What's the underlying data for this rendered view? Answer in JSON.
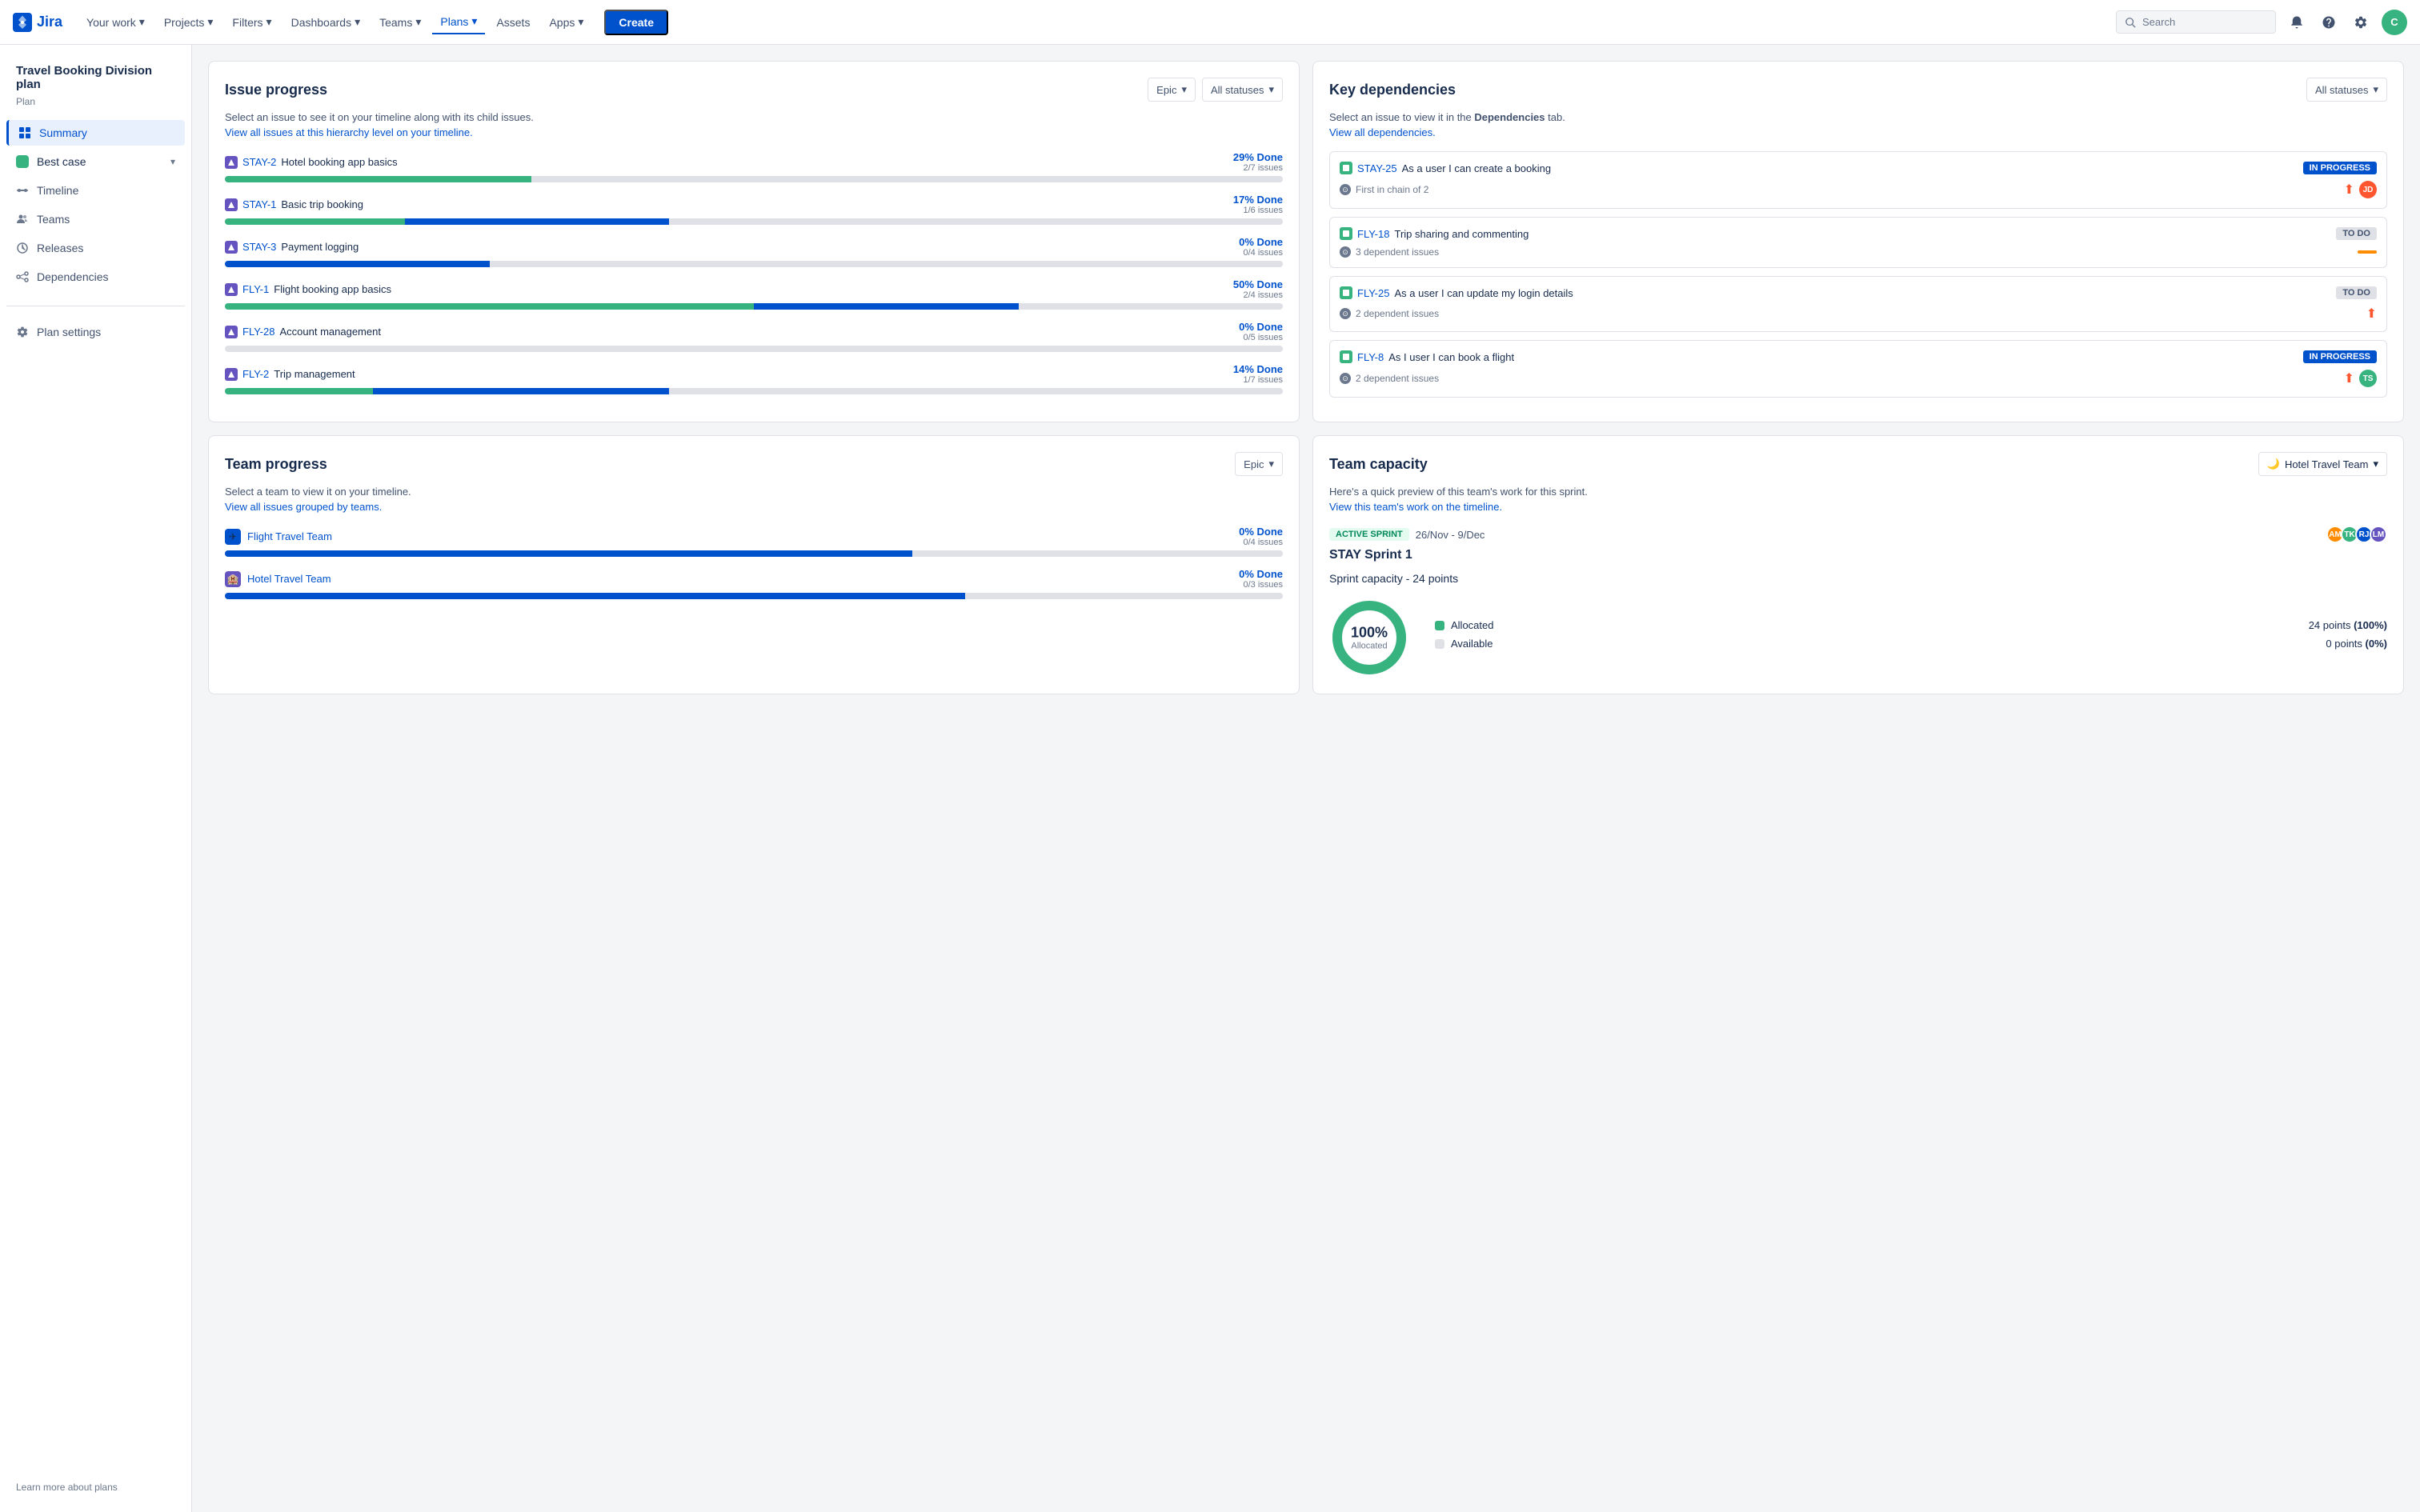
{
  "topnav": {
    "logo_text": "Jira",
    "items": [
      {
        "label": "Your work",
        "has_arrow": true
      },
      {
        "label": "Projects",
        "has_arrow": true
      },
      {
        "label": "Filters",
        "has_arrow": true
      },
      {
        "label": "Dashboards",
        "has_arrow": true
      },
      {
        "label": "Teams",
        "has_arrow": true
      },
      {
        "label": "Plans",
        "has_arrow": true,
        "active": true
      },
      {
        "label": "Assets"
      },
      {
        "label": "Apps",
        "has_arrow": true
      }
    ],
    "create_label": "Create",
    "search_placeholder": "Search",
    "avatar_initials": "C"
  },
  "sidebar": {
    "plan_title": "Travel Booking Division plan",
    "plan_subtitle": "Plan",
    "items": [
      {
        "label": "Summary",
        "active": true,
        "icon": "grid"
      },
      {
        "label": "Best case",
        "is_scenario": true
      },
      {
        "label": "Timeline",
        "icon": "timeline"
      },
      {
        "label": "Teams",
        "icon": "teams"
      },
      {
        "label": "Releases",
        "icon": "releases"
      },
      {
        "label": "Dependencies",
        "icon": "dependencies"
      }
    ],
    "settings_label": "Plan settings",
    "footer_link": "Learn more about plans"
  },
  "issue_progress": {
    "title": "Issue progress",
    "filter1": "Epic",
    "filter2": "All statuses",
    "subtitle": "Select an issue to see it on your timeline along with its child issues.",
    "link": "View all issues at this hierarchy level on your timeline.",
    "issues": [
      {
        "id": "STAY-2",
        "name": "Hotel booking app basics",
        "pct": "29% Done",
        "count": "2/7 issues",
        "green": 29,
        "blue": 0,
        "gray": 71
      },
      {
        "id": "STAY-1",
        "name": "Basic trip booking",
        "pct": "17% Done",
        "count": "1/6 issues",
        "green": 17,
        "blue": 25,
        "gray": 58
      },
      {
        "id": "STAY-3",
        "name": "Payment logging",
        "pct": "0% Done",
        "count": "0/4 issues",
        "green": 0,
        "blue": 25,
        "gray": 75
      },
      {
        "id": "FLY-1",
        "name": "Flight booking app basics",
        "pct": "50% Done",
        "count": "2/4 issues",
        "green": 50,
        "blue": 25,
        "gray": 25
      },
      {
        "id": "FLY-28",
        "name": "Account management",
        "pct": "0% Done",
        "count": "0/5 issues",
        "green": 0,
        "blue": 0,
        "gray": 100
      },
      {
        "id": "FLY-2",
        "name": "Trip management",
        "pct": "14% Done",
        "count": "1/7 issues",
        "green": 14,
        "blue": 28,
        "gray": 58
      }
    ]
  },
  "key_dependencies": {
    "title": "Key dependencies",
    "filter": "All statuses",
    "subtitle": "Select an issue to view it in the ",
    "subtitle_bold": "Dependencies",
    "subtitle_end": " tab.",
    "link": "View all dependencies.",
    "items": [
      {
        "id": "STAY-25",
        "name": "As a user I can create a booking",
        "badge": "IN PROGRESS",
        "badge_type": "inprogress",
        "sub": "First in chain of 2",
        "sub_icon": "chain",
        "avatar_color": "#ff5630",
        "avatar_initials": "JD",
        "has_up_arrow": true
      },
      {
        "id": "FLY-18",
        "name": "Trip sharing and commenting",
        "badge": "TO DO",
        "badge_type": "todo",
        "sub": "3 dependent issues",
        "sub_icon": "deps",
        "orange_bar": true,
        "has_up_arrow": false
      },
      {
        "id": "FLY-25",
        "name": "As a user I can update my login details",
        "badge": "TO DO",
        "badge_type": "todo",
        "sub": "2 dependent issues",
        "sub_icon": "deps",
        "red_bar": true,
        "has_up_arrow": false
      },
      {
        "id": "FLY-8",
        "name": "As I user I can book a flight",
        "badge": "IN PROGRESS",
        "badge_type": "inprogress",
        "sub": "2 dependent issues",
        "sub_icon": "deps",
        "avatar_color": "#36b37e",
        "avatar_initials": "TS",
        "has_up_arrow": true
      }
    ]
  },
  "team_progress": {
    "title": "Team progress",
    "filter": "Epic",
    "subtitle": "Select a team to view it on your timeline.",
    "link": "View all issues grouped by teams.",
    "teams": [
      {
        "name": "Flight Travel Team",
        "icon": "✈",
        "icon_bg": "#0052cc",
        "pct": "0% Done",
        "count": "0/4 issues",
        "blue": 65,
        "gray": 35
      },
      {
        "name": "Hotel Travel Team",
        "icon": "🏨",
        "icon_bg": "#6554c0",
        "pct": "0% Done",
        "count": "0/3 issues",
        "blue": 70,
        "gray": 30
      }
    ]
  },
  "team_capacity": {
    "title": "Team capacity",
    "team_name": "Hotel Travel Team",
    "team_icon": "🌙",
    "subtitle": "Here's a quick preview of this team's work for this sprint.",
    "link": "View this team's work on the timeline.",
    "sprint_badge": "ACTIVE SPRINT",
    "sprint_dates": "26/Nov - 9/Dec",
    "sprint_name": "STAY Sprint 1",
    "capacity_label": "Sprint capacity  -  24 points",
    "donut_pct": "100%",
    "donut_label": "Allocated",
    "legend": [
      {
        "color": "#36b37e",
        "label": "Allocated",
        "value": "24 points",
        "pct": "(100%)"
      },
      {
        "color": "#dfe1e6",
        "label": "Available",
        "value": "0 points",
        "pct": "(0%)"
      }
    ],
    "avatars": [
      {
        "color": "#ff8b00",
        "initials": "AM"
      },
      {
        "color": "#36b37e",
        "initials": "TK"
      },
      {
        "color": "#0052cc",
        "initials": "RJ"
      },
      {
        "color": "#6554c0",
        "initials": "LM"
      }
    ]
  }
}
